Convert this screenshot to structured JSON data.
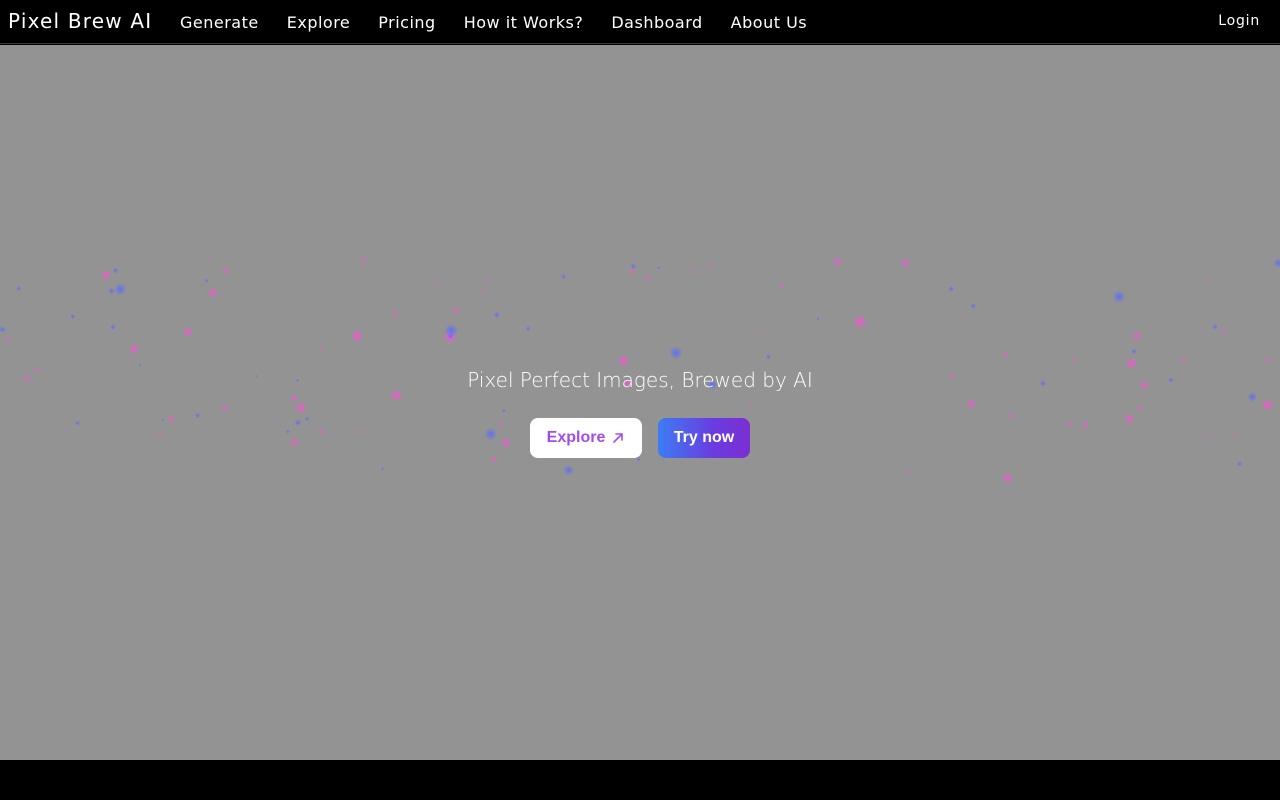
{
  "brand": {
    "name": "Pixel Brew AI"
  },
  "nav": {
    "items": [
      {
        "label": "Generate"
      },
      {
        "label": "Explore"
      },
      {
        "label": "Pricing"
      },
      {
        "label": "How it Works?"
      },
      {
        "label": "Dashboard"
      },
      {
        "label": "About Us"
      }
    ],
    "login_label": "Login"
  },
  "hero": {
    "tagline": "Pixel Perfect Images, Brewed by AI",
    "explore_label": "Explore",
    "try_label": "Try now"
  },
  "colors": {
    "hero_bg": "#939393",
    "accent_purple": "#a24cec",
    "gradient_start": "#3d7cf5",
    "gradient_end": "#7a2fd2"
  },
  "icons": {
    "explore_arrow": "arrow-up-right-icon"
  }
}
